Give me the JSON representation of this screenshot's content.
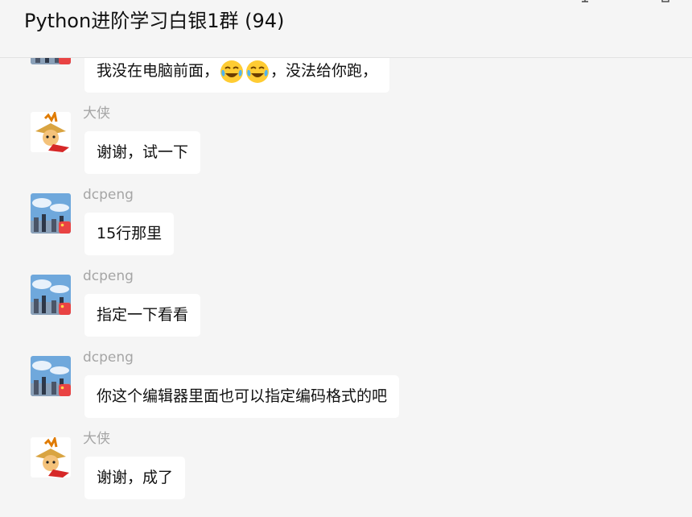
{
  "window": {
    "title": "Python进阶学习白银1群 (94)"
  },
  "messages": [
    {
      "sender": "",
      "text_before": "我没在电脑前面，",
      "emojis": [
        "tears-of-joy-emoji",
        "tears-of-joy-emoji"
      ],
      "text_after": "，没法给你跑，",
      "avatar": "dcpeng-avatar"
    },
    {
      "sender": "大侠",
      "text": "谢谢，试一下",
      "avatar": "daxia-avatar"
    },
    {
      "sender": "dcpeng",
      "text": "15行那里",
      "avatar": "dcpeng-avatar"
    },
    {
      "sender": "dcpeng",
      "text": "指定一下看看",
      "avatar": "dcpeng-avatar"
    },
    {
      "sender": "dcpeng",
      "text": "你这个编辑器里面也可以指定编码格式的吧",
      "avatar": "dcpeng-avatar"
    },
    {
      "sender": "大侠",
      "text": "谢谢，成了",
      "avatar": "daxia-avatar"
    }
  ],
  "colors": {
    "background": "#f5f5f5",
    "bubble": "#ffffff",
    "sender_name": "#a5a5a5",
    "text": "#111111"
  }
}
